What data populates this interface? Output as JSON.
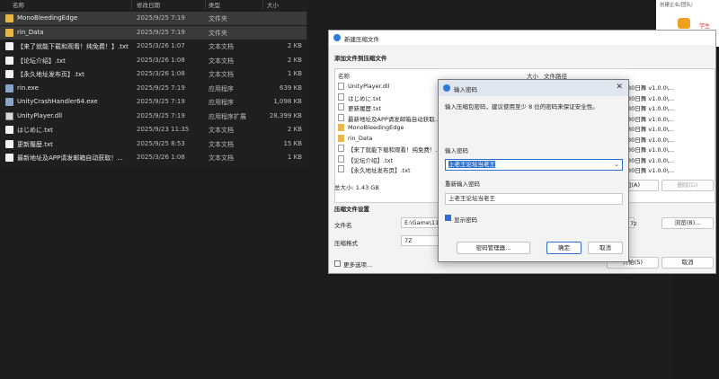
{
  "explorer": {
    "headers": {
      "name": "名称",
      "date": "修改日期",
      "type": "类型",
      "size": "大小"
    },
    "files": [
      {
        "name": "MonoBleedingEdge",
        "date": "2025/9/25 7:19",
        "type": "文件夹",
        "size": "",
        "icon": "folder-icon"
      },
      {
        "name": "rin_Data",
        "date": "2025/9/25 7:19",
        "type": "文件夹",
        "size": "",
        "icon": "folder-icon"
      },
      {
        "name": "【来了就能下载和观看！纯免费！】.txt",
        "date": "2025/3/26 1:07",
        "type": "文本文档",
        "size": "2 KB",
        "icon": "text-file-icon"
      },
      {
        "name": "【论坛介绍】.txt",
        "date": "2025/3/26 1:08",
        "type": "文本文档",
        "size": "2 KB",
        "icon": "text-file-icon"
      },
      {
        "name": "【永久地址发布页】.txt",
        "date": "2025/3/26 1:08",
        "type": "文本文档",
        "size": "1 KB",
        "icon": "text-file-icon"
      },
      {
        "name": "rin.exe",
        "date": "2025/9/25 7:19",
        "type": "应用程序",
        "size": "639 KB",
        "icon": "exe-icon"
      },
      {
        "name": "UnityCrashHandler64.exe",
        "date": "2025/9/25 7:19",
        "type": "应用程序",
        "size": "1,098 KB",
        "icon": "exe-icon"
      },
      {
        "name": "UnityPlayer.dll",
        "date": "2025/9/25 7:19",
        "type": "应用程序扩展",
        "size": "28,399 KB",
        "icon": "dll-icon"
      },
      {
        "name": "はじめに.txt",
        "date": "2025/9/23 11:35",
        "type": "文本文档",
        "size": "2 KB",
        "icon": "text-file-icon"
      },
      {
        "name": "更新履歴.txt",
        "date": "2025/9/25 8:53",
        "type": "文本文档",
        "size": "15 KB",
        "icon": "text-file-icon"
      },
      {
        "name": "最新地址及APP请发邮箱自动获取！...",
        "date": "2025/3/26 1:08",
        "type": "文本文档",
        "size": "1 KB",
        "icon": "text-file-icon"
      }
    ]
  },
  "side_panel": {
    "top_text": "创建企业/团队/",
    "badge_text": "学生"
  },
  "compress_dialog": {
    "title": "新建压缩文件",
    "add_section": "添加文件到压缩文件",
    "list_headers": {
      "name": "名称",
      "size": "大小",
      "path": "文件路径"
    },
    "items": [
      {
        "name": "UnityPlayer.dll",
        "icon": "file"
      },
      {
        "name": "はじめに.txt",
        "icon": "file"
      },
      {
        "name": "更新履歴.txt",
        "icon": "file"
      },
      {
        "name": "最新地址及APP请发邮箱自动获取...",
        "icon": "file"
      },
      {
        "name": "MonoBleedingEdge",
        "icon": "folder"
      },
      {
        "name": "rin_Data",
        "icon": "folder"
      },
      {
        "name": "【来了就能下载和观看！纯免费！...",
        "icon": "file"
      },
      {
        "name": "【论坛介绍】.txt",
        "icon": "file"
      },
      {
        "name": "【永久地址发布页】.txt",
        "icon": "file"
      }
    ],
    "paths": [
      "30日舞 v1.0.0\\...",
      "30日舞 v1.0.0\\...",
      "30日舞 v1.0.0\\...",
      "30日舞 v1.0.0\\...",
      "30日舞 v1.0.0\\...",
      "30日舞 v1.0.0\\...",
      "30日舞 v1.0.0\\...",
      "30日舞 v1.0.0\\...",
      "30日舞 v1.0.0\\..."
    ],
    "total_size": "总大小: 1.43 GB",
    "add_button": "加(A)",
    "delete_button": "删除(D)",
    "settings_section": "压缩文件设置",
    "filename_label": "文件名",
    "filename_value": "E:\\Game\\111",
    "filename_ext": "7z",
    "browse_button": "浏览(B)...",
    "format_label": "压缩格式",
    "format_value": "7Z",
    "more_options": "更多选项...",
    "start_button": "开始(S)",
    "cancel_button": "取消"
  },
  "password_dialog": {
    "title": "输入密码",
    "instruction": "输入压缩包密码，建议使用至少 8 位的密码来保证安全性。",
    "enter_label": "输入密码",
    "enter_value": "上老王论坛当老王",
    "reenter_label": "重新输入密码",
    "reenter_value": "上老王论坛当老王",
    "show_password": "显示密码",
    "manager_button": "密码管理器...",
    "ok_button": "确定",
    "cancel_button": "取消"
  }
}
